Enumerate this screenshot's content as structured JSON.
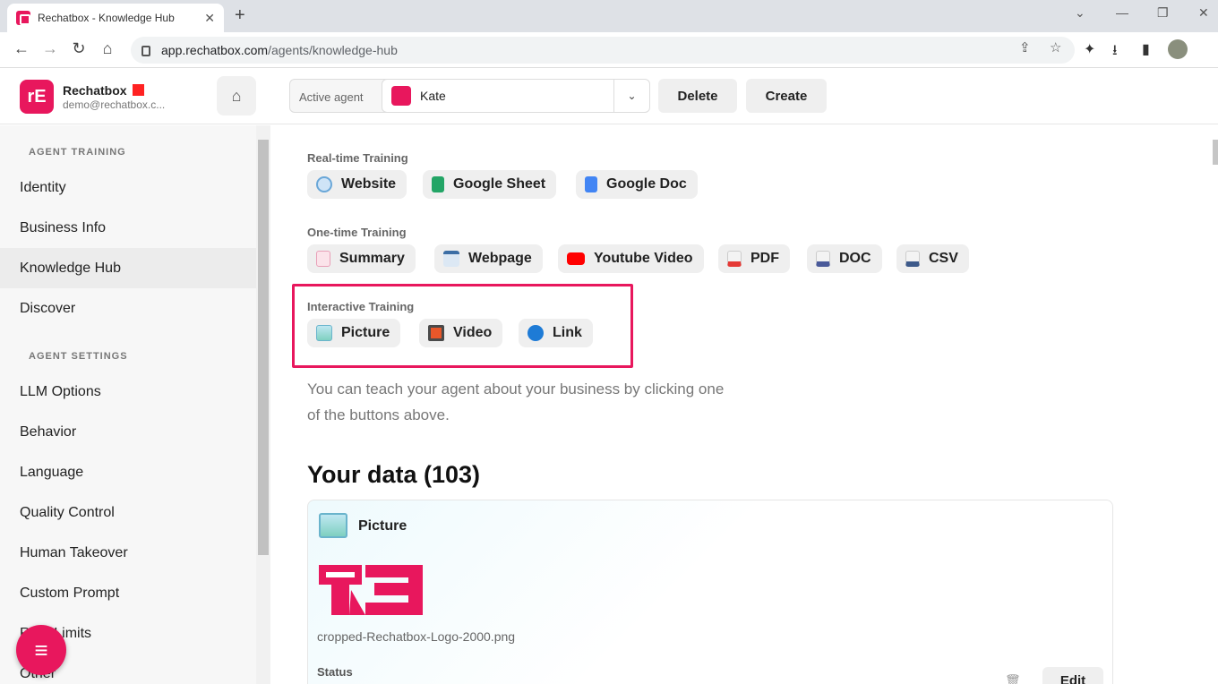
{
  "browser": {
    "tab_title": "Rechatbox - Knowledge Hub",
    "tab_close": "✕",
    "new_tab": "+",
    "url_host": "app.rechatbox.com",
    "url_path": "/agents/knowledge-hub",
    "back_icon": "←",
    "forward_icon": "→",
    "reload_icon": "↻",
    "home_icon": "⌂",
    "share_icon": "⇪",
    "star_icon": "☆",
    "ext_icon": "✦",
    "download_icon": "⭳",
    "sidepanel_icon": "▮",
    "minimize": "—",
    "restore": "❐",
    "close": "✕",
    "chevron": "⌄"
  },
  "header": {
    "brand": "Rechatbox",
    "email": "demo@rechatbox.c...",
    "logo_text": "rE",
    "home_icon": "⌂",
    "active_agent_label": "Active agent",
    "agent_name": "Kate",
    "chevron": "⌄",
    "delete_label": "Delete",
    "create_label": "Create"
  },
  "sidebar": {
    "section1": "AGENT TRAINING",
    "section2": "AGENT SETTINGS",
    "items_training": [
      "Identity",
      "Business Info",
      "Knowledge Hub",
      "Discover"
    ],
    "items_settings": [
      "LLM Options",
      "Behavior",
      "Language",
      "Quality Control",
      "Human Takeover",
      "Custom Prompt",
      "Rate Limits",
      "Other"
    ],
    "fab_icon": "≡"
  },
  "main": {
    "realtime_label": "Real-time Training",
    "realtime": [
      "Website",
      "Google Sheet",
      "Google Doc"
    ],
    "onetime_label": "One-time Training",
    "onetime": [
      "Summary",
      "Webpage",
      "Youtube Video",
      "PDF",
      "DOC",
      "CSV"
    ],
    "interactive_label": "Interactive Training",
    "interactive": [
      "Picture",
      "Video",
      "Link"
    ],
    "hint": "You can teach your agent about your business by clicking one of the buttons above.",
    "your_data": "Your data (103)",
    "card": {
      "title": "Picture",
      "filename": "cropped-Rechatbox-Logo-2000.png",
      "status_label": "Status",
      "edit_label": "Edit",
      "trash_icon": "🗑"
    }
  },
  "colors": {
    "brand": "#e8175d",
    "highlight": "#e8175d"
  }
}
